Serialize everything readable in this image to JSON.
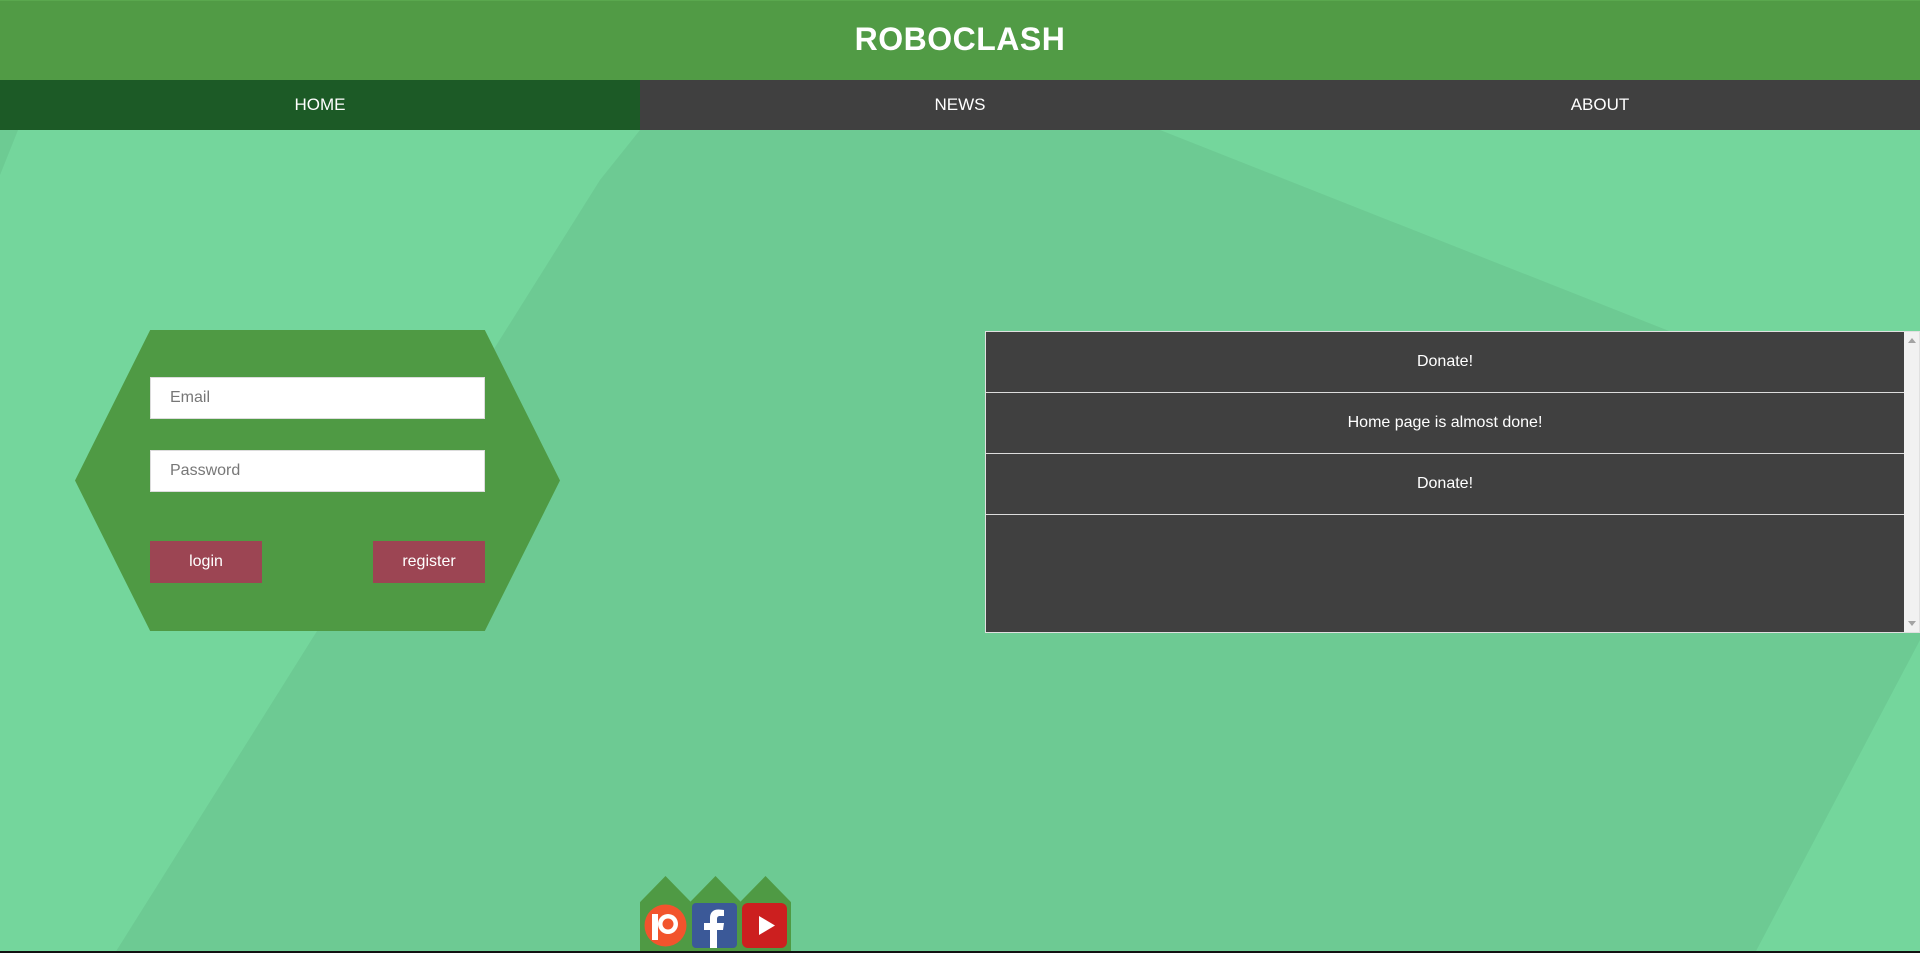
{
  "header": {
    "title": "ROBOCLASH"
  },
  "nav": {
    "items": [
      "HOME",
      "NEWS",
      "ABOUT"
    ],
    "active": "HOME"
  },
  "login": {
    "email_placeholder": "Email",
    "password_placeholder": "Password",
    "login_label": "login",
    "register_label": "register"
  },
  "news": {
    "items": [
      "Donate!",
      "Home page is almost done!",
      "Donate!"
    ]
  },
  "social": {
    "icons": [
      "patreon-icon",
      "facebook-icon",
      "youtube-icon"
    ]
  },
  "colors": {
    "background": "#74d69c",
    "header": "#519b45",
    "nav": "#404040",
    "nav_active": "#1c5a26",
    "button": "#9c4553",
    "panel": "#404040"
  }
}
